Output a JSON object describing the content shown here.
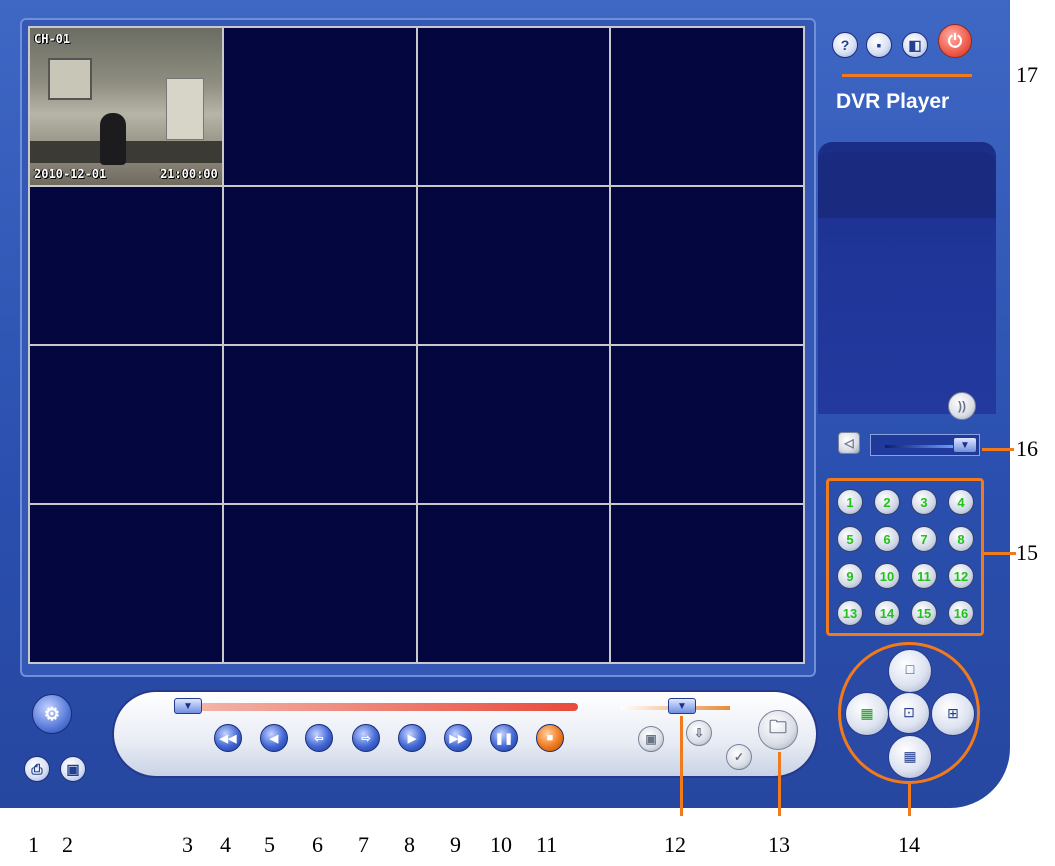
{
  "app": {
    "title": "DVR Player"
  },
  "video": {
    "channel_label": "CH-01",
    "date": "2010-12-01",
    "time": "21:00:00"
  },
  "top_buttons": [
    {
      "icon": "help-icon",
      "glyph": "?"
    },
    {
      "icon": "minimize-icon",
      "glyph": "▪"
    },
    {
      "icon": "restore-icon",
      "glyph": "◧"
    },
    {
      "icon": "power-icon",
      "glyph": "⏻"
    }
  ],
  "channels": [
    "1",
    "2",
    "3",
    "4",
    "5",
    "6",
    "7",
    "8",
    "9",
    "10",
    "11",
    "12",
    "13",
    "14",
    "15",
    "16"
  ],
  "playback_buttons": [
    {
      "icon": "fast-rewind-icon",
      "glyph": "◀◀"
    },
    {
      "icon": "play-reverse-icon",
      "glyph": "◀"
    },
    {
      "icon": "step-back-icon",
      "glyph": "⇦"
    },
    {
      "icon": "step-forward-icon",
      "glyph": "⇨"
    },
    {
      "icon": "play-icon",
      "glyph": "▶"
    },
    {
      "icon": "fast-forward-icon",
      "glyph": "▶▶"
    },
    {
      "icon": "pause-icon",
      "glyph": "❚❚"
    },
    {
      "icon": "stop-icon",
      "glyph": "■"
    }
  ],
  "callouts": [
    "1",
    "2",
    "3",
    "4",
    "5",
    "6",
    "7",
    "8",
    "9",
    "10",
    "11",
    "12",
    "13",
    "14",
    "15",
    "16",
    "17"
  ],
  "colors": {
    "accent": "#f07a1c",
    "panel": "#2f55b4",
    "video_bg": "#04073f",
    "channel_text": "#22c21b"
  }
}
